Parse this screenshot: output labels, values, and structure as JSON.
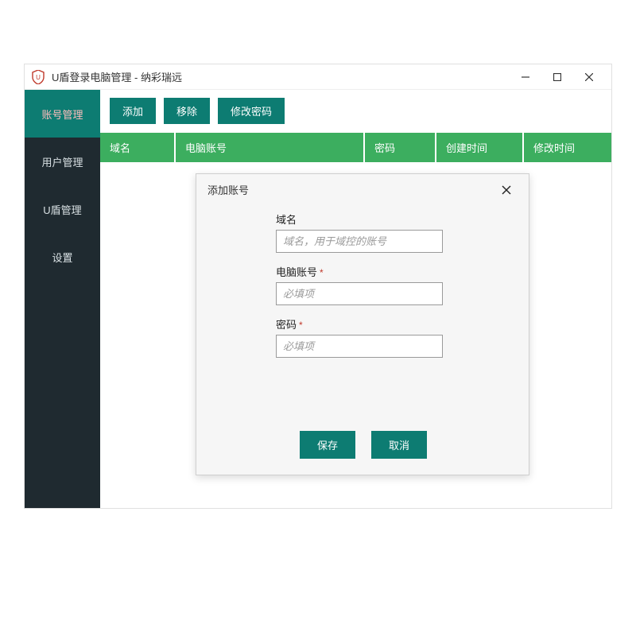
{
  "window": {
    "title": "U盾登录电脑管理 - 纳彩瑞远"
  },
  "sidebar": {
    "items": [
      {
        "label": "账号管理",
        "active": true
      },
      {
        "label": "用户管理",
        "active": false
      },
      {
        "label": "U盾管理",
        "active": false
      },
      {
        "label": "设置",
        "active": false
      }
    ]
  },
  "toolbar": {
    "add_label": "添加",
    "remove_label": "移除",
    "changepw_label": "修改密码"
  },
  "table": {
    "columns": {
      "domain": "域名",
      "account": "电脑账号",
      "password": "密码",
      "created": "创建时间",
      "modified": "修改时间"
    }
  },
  "modal": {
    "title": "添加账号",
    "fields": {
      "domain_label": "域名",
      "domain_placeholder": "域名，用于域控的账号",
      "account_label": "电脑账号",
      "account_placeholder": "必填项",
      "password_label": "密码",
      "password_placeholder": "必填项",
      "required_marker": "*"
    },
    "save_label": "保存",
    "cancel_label": "取消"
  }
}
